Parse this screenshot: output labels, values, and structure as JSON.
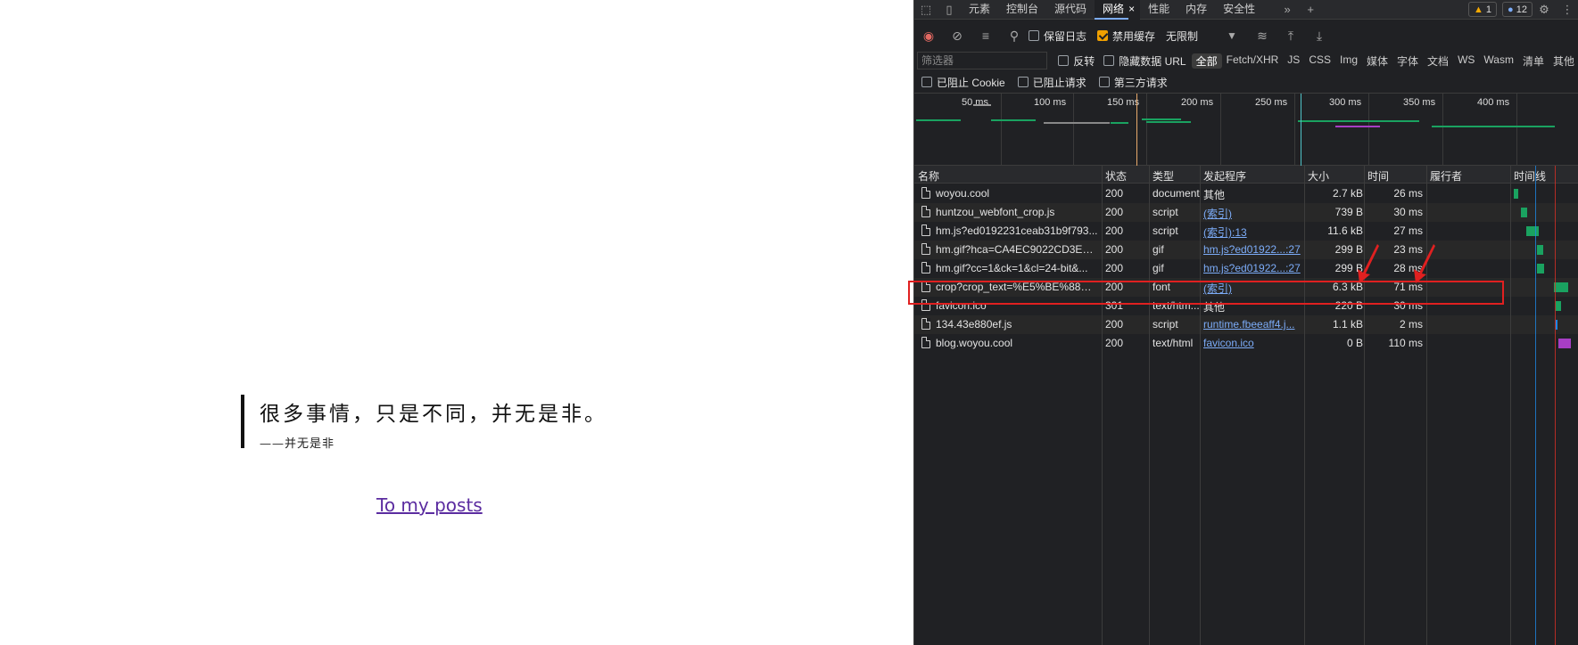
{
  "page": {
    "quote_text": "很多事情，只是不同，并无是非。",
    "quote_author": "——并无是非",
    "posts_link": "To my posts"
  },
  "devtools": {
    "tabs": [
      "元素",
      "控制台",
      "源代码",
      "网络",
      "性能",
      "内存",
      "安全性"
    ],
    "active_tab": "网络",
    "warnings": "1",
    "messages": "12",
    "toolbar": {
      "preserve_log": "保留日志",
      "disable_cache": "禁用缓存",
      "disable_cache_checked": true,
      "throttle": "无限制"
    },
    "filter": {
      "placeholder": "筛选器",
      "invert": "反转",
      "hide_data_urls": "隐藏数据 URL",
      "types": [
        "全部",
        "Fetch/XHR",
        "JS",
        "CSS",
        "Img",
        "媒体",
        "字体",
        "文档",
        "WS",
        "Wasm",
        "清单",
        "其他"
      ],
      "selected_type": "全部",
      "blocked_cookies": "已阻止 Cookie",
      "blocked_requests": "已阻止请求",
      "third_party": "第三方请求"
    },
    "timeline_ticks": [
      "50 ms",
      "100 ms",
      "150 ms",
      "200 ms",
      "250 ms",
      "300 ms",
      "350 ms",
      "400 ms"
    ],
    "columns": [
      "名称",
      "状态",
      "类型",
      "发起程序",
      "大小",
      "时间",
      "履行者",
      "时间线"
    ],
    "rows": [
      {
        "name": "woyou.cool",
        "status": "200",
        "type": "document",
        "initiator": "其他",
        "initiator_link": false,
        "size": "2.7 kB",
        "time": "26 ms"
      },
      {
        "name": "huntzou_webfont_crop.js",
        "status": "200",
        "type": "script",
        "initiator": "(索引)",
        "initiator_link": true,
        "size": "739 B",
        "time": "30 ms"
      },
      {
        "name": "hm.js?ed0192231ceab31b9f793...",
        "status": "200",
        "type": "script",
        "initiator": "(索引):13",
        "initiator_link": true,
        "size": "11.6 kB",
        "time": "27 ms"
      },
      {
        "name": "hm.gif?hca=CA4EC9022CD3ECD...",
        "status": "200",
        "type": "gif",
        "initiator": "hm.js?ed01922...:27",
        "initiator_link": true,
        "size": "299 B",
        "time": "23 ms"
      },
      {
        "name": "hm.gif?cc=1&ck=1&cl=24-bit&...",
        "status": "200",
        "type": "gif",
        "initiator": "hm.js?ed01922...:27",
        "initiator_link": true,
        "size": "299 B",
        "time": "28 ms"
      },
      {
        "name": "crop?crop_text=%E5%BE%88%E...",
        "status": "200",
        "type": "font",
        "initiator": "(索引)",
        "initiator_link": true,
        "size": "6.3 kB",
        "time": "71 ms"
      },
      {
        "name": "favicon.ico",
        "status": "301",
        "type": "text/htm...",
        "initiator": "其他",
        "initiator_link": false,
        "size": "220 B",
        "time": "30 ms"
      },
      {
        "name": "134.43e880ef.js",
        "status": "200",
        "type": "script",
        "initiator": "runtime.fbeeaff4.j...",
        "initiator_link": true,
        "size": "1.1 kB",
        "time": "2 ms"
      },
      {
        "name": "blog.woyou.cool",
        "status": "200",
        "type": "text/html",
        "initiator": "favicon.ico",
        "initiator_link": true,
        "size": "0 B",
        "time": "110 ms"
      }
    ]
  }
}
